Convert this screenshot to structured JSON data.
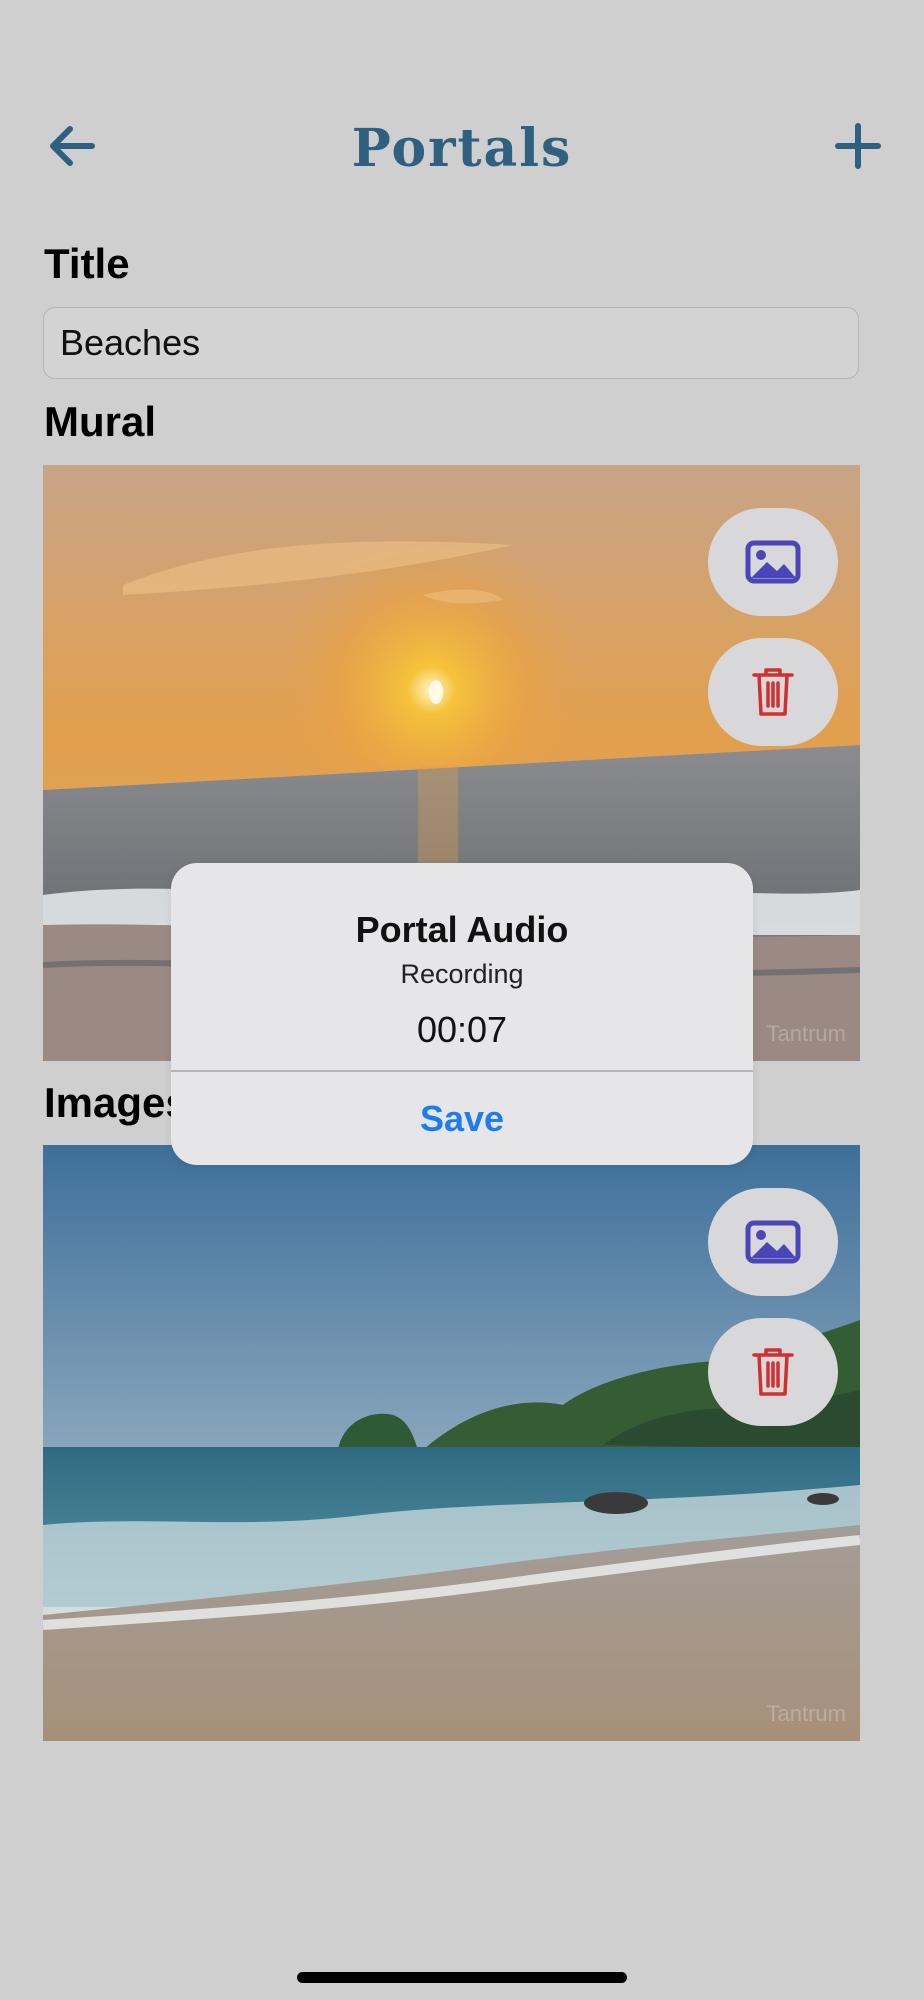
{
  "nav": {
    "title": "Portals",
    "back_icon": "arrow-left-icon",
    "add_icon": "plus-icon"
  },
  "form": {
    "title_label": "Title",
    "title_value": "Beaches",
    "mural_label": "Mural",
    "images_label": "Images"
  },
  "mural": {
    "watermark": "Tantrum",
    "change_icon": "image-icon",
    "delete_icon": "trash-icon"
  },
  "image": {
    "watermark": "Tantrum",
    "change_icon": "image-icon",
    "delete_icon": "trash-icon"
  },
  "dialog": {
    "title": "Portal Audio",
    "subtitle": "Recording",
    "timer": "00:07",
    "save_label": "Save"
  },
  "colors": {
    "accent": "#2f6080",
    "icon_purple": "#4a46b8",
    "delete_red": "#d03030",
    "link_blue": "#1c7cf0"
  }
}
